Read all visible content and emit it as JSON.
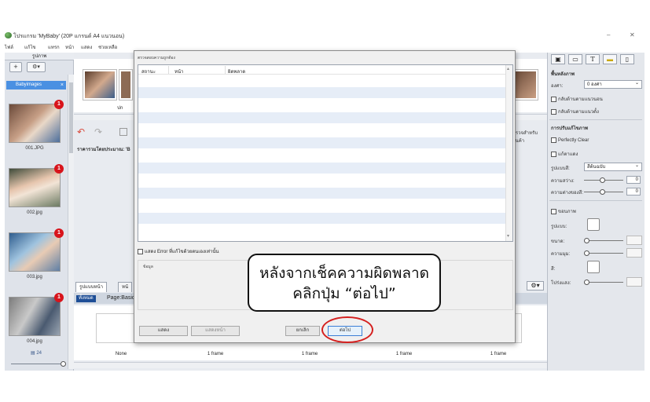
{
  "window": {
    "title": "โปรแกรม 'MyBaby' (20P แกรนด์ A4 แนวนอน)",
    "controls": [
      "–",
      "✕"
    ]
  },
  "menu": [
    "ไฟล์",
    "แก้ไข",
    "แทรก",
    "หน้า",
    "แสดง",
    "ช่วยเหลือ"
  ],
  "left_panel": {
    "header": "รูปภาพ",
    "album_tab": "Babyimages",
    "tools": [
      "+",
      "⚙▾"
    ],
    "photos": [
      {
        "caption": "001.JPG",
        "badge": "1"
      },
      {
        "caption": "002.jpg",
        "badge": "1"
      },
      {
        "caption": "003.jpg",
        "badge": "1"
      },
      {
        "caption": "004.jpg",
        "badge": "1"
      }
    ],
    "count": "24"
  },
  "center": {
    "strip_caption": "ปก",
    "price_label": "ราคารวมโดยประมาณ: 'B",
    "right_label": "ตรวจสำหรับสินค้า",
    "tabs": [
      "รูปแบบหน้า",
      "หน้"
    ],
    "subbar_all": "ทั้งหมด",
    "subbar_page": "Page:Basic",
    "frames": [
      "None",
      "1 frame",
      "1 frame",
      "1 frame",
      "1 frame"
    ]
  },
  "right_panel": {
    "section_background": "พื้นหลังภาพ",
    "angle_label": "องศา:",
    "angle_value": "0 องศา",
    "flip_h": "กลับด้านตามแนวนอน",
    "flip_v": "กลับด้านตามแนวตั้ง",
    "section_adjust": "การปรับแก้ไขภาพ",
    "perfectly_clear": "Perfectly Clear",
    "auto": "แก้ตาแดง",
    "mode_label": "รูปแบบสี:",
    "mode_value": "สีต้นฉบับ",
    "brightness_label": "ความสว่าง:",
    "brightness_value": "0",
    "contrast_label": "ความต่างของสี:",
    "contrast_value": "0",
    "frame_check": "ขอบภาพ",
    "frame_type": "รูปแบบ:",
    "frame_size": "ขนาด:",
    "frame_round": "ความมุม:",
    "frame_color": "สี:",
    "frame_alpha": "โปร่งแสง:"
  },
  "dialog": {
    "title": "ตรวจสอบความถูกต้อง",
    "columns": [
      "สถานะ",
      "หน้า",
      "ผิดพลาด"
    ],
    "show_errors_checkbox": "แสดง Error ที่แก้ไขด้วยตนเองเท่านั้น",
    "info_legend": "ข้อมูล",
    "buttons": {
      "show": "แสดง",
      "show_page": "แสดงหน้า",
      "cancel": "ยกเลิก",
      "next": "ต่อไป"
    }
  },
  "callout": {
    "line1": "หลังจากเช็คความผิดพลาด",
    "line2": "คลิกปุ่ม “ต่อไป”"
  },
  "colors": {
    "accent_blue": "#4a90e2",
    "badge_red": "#d8141b",
    "highlight_red": "#d5201f",
    "list_alt_row": "#e6edf7"
  }
}
